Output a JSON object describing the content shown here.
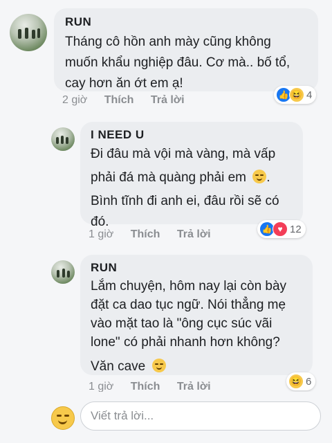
{
  "comments": [
    {
      "author": "RUN",
      "lines": [
        "Tháng cô hồn anh mày cũng không",
        "muốn khẩu nghiệp đâu. Cơ mà.. bố tổ,",
        "cay hơn ăn ớt em ạ!"
      ],
      "time": "2 giờ",
      "like_label": "Thích",
      "reply_label": "Trả lời",
      "reaction_count": "4"
    },
    {
      "author": "I NEED U",
      "lines": [
        "Đi đâu mà vội mà vàng, mà vấp",
        "phải đá mà quàng phải em",
        "Bình tĩnh đi anh ei, đâu rồi sẽ có",
        "đó."
      ],
      "time": "1 giờ",
      "like_label": "Thích",
      "reply_label": "Trả lời",
      "reaction_count": "12"
    },
    {
      "author": "RUN",
      "lines": [
        "Lắm chuyện, hôm nay lại còn bày",
        "đặt ca dao tục ngữ. Nói thẳng mẹ",
        "vào mặt tao là \"ông cục súc vãi",
        "lone\" có phải nhanh hơn không?",
        "Văn cave"
      ],
      "time": "1 giờ",
      "like_label": "Thích",
      "reply_label": "Trả lời",
      "reaction_count": "6"
    }
  ],
  "composer": {
    "placeholder": "Viết trả lời..."
  },
  "icons": {
    "like": "thumbs-up-icon",
    "haha": "laughing-emoji-icon",
    "love": "heart-icon",
    "smirk": "smirk-emoji-icon",
    "composer": "smiley-emoji-icon"
  },
  "colors": {
    "like": "#1877f2",
    "love": "#f33e58",
    "haha": "#f7c94b",
    "bubble": "#ebedf0"
  }
}
